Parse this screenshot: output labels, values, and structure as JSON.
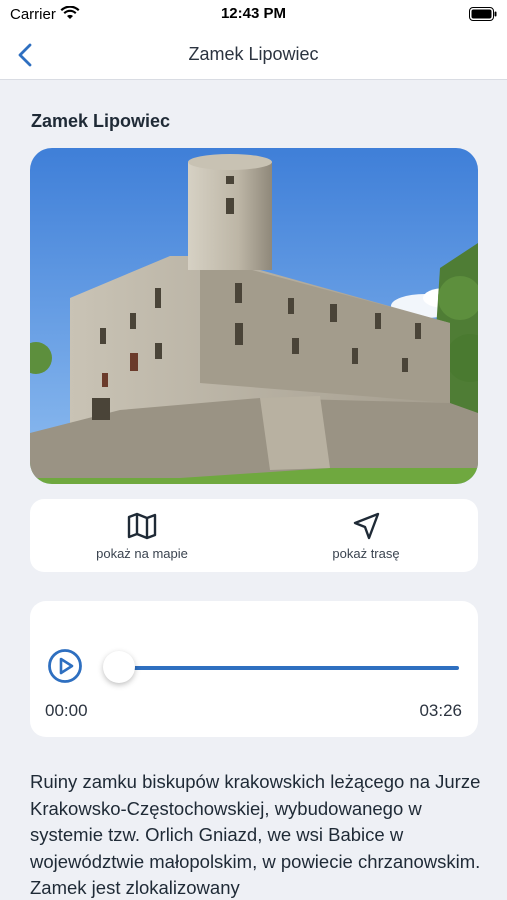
{
  "status_bar": {
    "carrier": "Carrier",
    "time": "12:43 PM",
    "wifi_icon": "wifi-icon",
    "battery_icon": "battery-icon"
  },
  "nav": {
    "back_icon": "chevron-left-icon",
    "title": "Zamek Lipowiec"
  },
  "section_title": "Zamek Lipowiec",
  "photo": {
    "subject": "castle-photo"
  },
  "actions": {
    "show_on_map": {
      "label": "pokaż na mapie",
      "icon": "map-icon"
    },
    "show_route": {
      "label": "pokaż trasę",
      "icon": "navigation-arrow-icon"
    }
  },
  "player": {
    "play_icon": "play-icon",
    "current_time": "00:00",
    "total_time": "03:26",
    "progress": 0,
    "accent_color": "#2e6fc0"
  },
  "description": "Ruiny zamku biskupów krakowskich leżącego na Jurze Krakowsko-Częstochowskiej, wybudowanego w systemie tzw. Orlich Gniazd, we wsi Babice w województwie małopolskim, w powiecie chrzanowskim. Zamek jest zlokalizowany",
  "colors": {
    "background": "#eef0f5",
    "accent": "#2e6fc0",
    "card": "#ffffff"
  }
}
